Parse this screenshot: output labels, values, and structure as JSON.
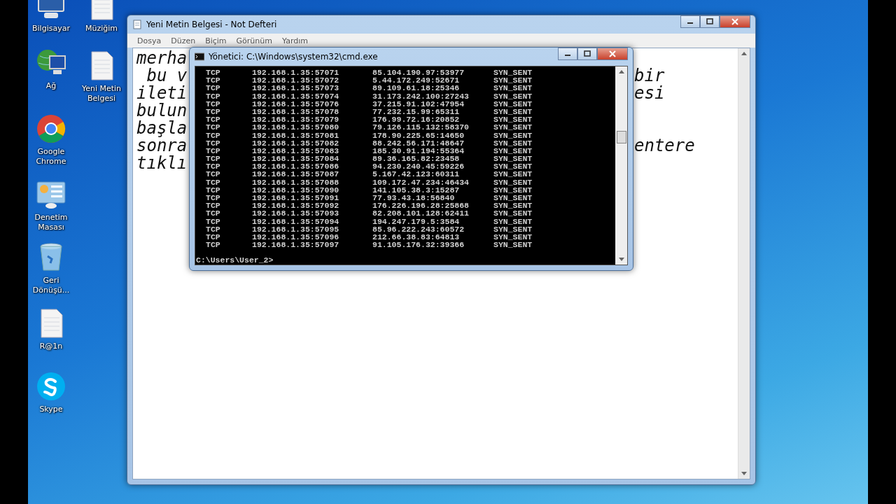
{
  "desktop_icons": [
    {
      "label": "Bilgisayar",
      "kind": "computer"
    },
    {
      "label": "Müziğim",
      "kind": "document"
    },
    {
      "label": "Ağ",
      "kind": "network"
    },
    {
      "label": "Yeni Metin Belgesi",
      "kind": "document"
    },
    {
      "label": "Google Chrome",
      "kind": "chrome"
    },
    {
      "label": "Denetim Masası",
      "kind": "control-panel"
    },
    {
      "label": "Geri Dönüşü...",
      "kind": "recycle-bin"
    },
    {
      "label": "R@1n",
      "kind": "document"
    },
    {
      "label": "Skype",
      "kind": "skype"
    }
  ],
  "notepad": {
    "title": "Yeni Metin Belgesi - Not Defteri",
    "menu": [
      "Dosya",
      "Düzen",
      "Biçim",
      "Görünüm",
      "Yardım"
    ],
    "lines": [
      {
        "left": "merha"
      },
      {
        "left": " bu v",
        "right": "bir"
      },
      {
        "left": "ileti",
        "right": "esi"
      },
      {
        "left": "bulun"
      },
      {
        "left": "başla"
      },
      {
        "left": "sonra",
        "right": "entere"
      },
      {
        "left": "tıklı"
      }
    ]
  },
  "cmd": {
    "title": "Yönetici: C:\\Windows\\system32\\cmd.exe",
    "rows": [
      {
        "proto": "TCP",
        "local": "192.168.1.35:57071",
        "foreign": "85.104.190.97:53977",
        "state": "SYN_SENT"
      },
      {
        "proto": "TCP",
        "local": "192.168.1.35:57072",
        "foreign": "5.44.172.249:52671",
        "state": "SYN_SENT"
      },
      {
        "proto": "TCP",
        "local": "192.168.1.35:57073",
        "foreign": "89.109.61.18:25346",
        "state": "SYN_SENT"
      },
      {
        "proto": "TCP",
        "local": "192.168.1.35:57074",
        "foreign": "31.173.242.100:27243",
        "state": "SYN_SENT"
      },
      {
        "proto": "TCP",
        "local": "192.168.1.35:57076",
        "foreign": "37.215.91.102:47954",
        "state": "SYN_SENT"
      },
      {
        "proto": "TCP",
        "local": "192.168.1.35:57078",
        "foreign": "77.232.15.99:65311",
        "state": "SYN_SENT"
      },
      {
        "proto": "TCP",
        "local": "192.168.1.35:57079",
        "foreign": "176.99.72.16:20852",
        "state": "SYN_SENT"
      },
      {
        "proto": "TCP",
        "local": "192.168.1.35:57080",
        "foreign": "79.126.115.132:58370",
        "state": "SYN_SENT"
      },
      {
        "proto": "TCP",
        "local": "192.168.1.35:57081",
        "foreign": "178.90.225.65:14650",
        "state": "SYN_SENT"
      },
      {
        "proto": "TCP",
        "local": "192.168.1.35:57082",
        "foreign": "88.242.56.171:48647",
        "state": "SYN_SENT"
      },
      {
        "proto": "TCP",
        "local": "192.168.1.35:57083",
        "foreign": "185.30.91.194:55364",
        "state": "SYN_SENT"
      },
      {
        "proto": "TCP",
        "local": "192.168.1.35:57084",
        "foreign": "89.36.165.82:23458",
        "state": "SYN_SENT"
      },
      {
        "proto": "TCP",
        "local": "192.168.1.35:57086",
        "foreign": "94.230.240.45:59226",
        "state": "SYN_SENT"
      },
      {
        "proto": "TCP",
        "local": "192.168.1.35:57087",
        "foreign": "5.167.42.123:60311",
        "state": "SYN_SENT"
      },
      {
        "proto": "TCP",
        "local": "192.168.1.35:57088",
        "foreign": "109.172.47.234:46434",
        "state": "SYN_SENT"
      },
      {
        "proto": "TCP",
        "local": "192.168.1.35:57090",
        "foreign": "141.105.38.3:15287",
        "state": "SYN_SENT"
      },
      {
        "proto": "TCP",
        "local": "192.168.1.35:57091",
        "foreign": "77.93.43.18:56840",
        "state": "SYN_SENT"
      },
      {
        "proto": "TCP",
        "local": "192.168.1.35:57092",
        "foreign": "176.226.196.28:25868",
        "state": "SYN_SENT"
      },
      {
        "proto": "TCP",
        "local": "192.168.1.35:57093",
        "foreign": "82.208.101.128:62411",
        "state": "SYN_SENT"
      },
      {
        "proto": "TCP",
        "local": "192.168.1.35:57094",
        "foreign": "194.247.179.5:3584",
        "state": "SYN_SENT"
      },
      {
        "proto": "TCP",
        "local": "192.168.1.35:57095",
        "foreign": "85.96.222.243:60572",
        "state": "SYN_SENT"
      },
      {
        "proto": "TCP",
        "local": "192.168.1.35:57096",
        "foreign": "212.66.38.83:64813",
        "state": "SYN_SENT"
      },
      {
        "proto": "TCP",
        "local": "192.168.1.35:57097",
        "foreign": "91.105.176.32:39366",
        "state": "SYN_SENT"
      }
    ],
    "prompt": "C:\\Users\\User_2>"
  }
}
